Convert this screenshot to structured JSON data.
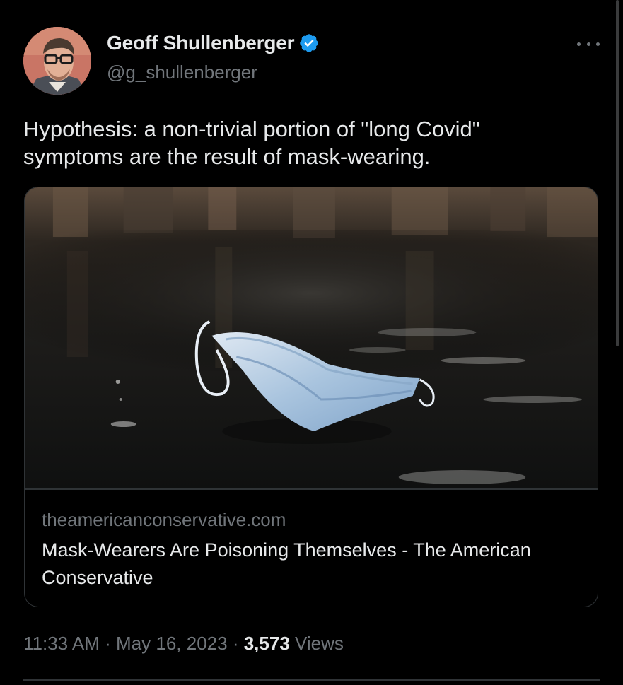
{
  "tweet": {
    "author": {
      "display_name": "Geoff Shullenberger",
      "handle": "@g_shullenberger",
      "verified": true
    },
    "text": "Hypothesis: a non-trivial portion of \"long Covid\"\nsymptoms are the result of mask-wearing.",
    "link_card": {
      "domain": "theamericanconservative.com",
      "title": "Mask-Wearers Are Poisoning Themselves - The American Conservative",
      "image_subject": "discarded surgical mask in a puddle"
    },
    "meta": {
      "time": "11:33 AM",
      "separator_1": " · ",
      "date": "May 16, 2023",
      "separator_2": " · ",
      "views_count": "3,573",
      "views_label": " Views"
    }
  },
  "icons": {
    "verified": "verified-badge-icon",
    "more": "more-options-icon"
  },
  "colors": {
    "background": "#000000",
    "text_primary": "#e7e9ea",
    "text_secondary": "#71767b",
    "verified_blue": "#1d9bf0",
    "border": "#2f3336"
  }
}
